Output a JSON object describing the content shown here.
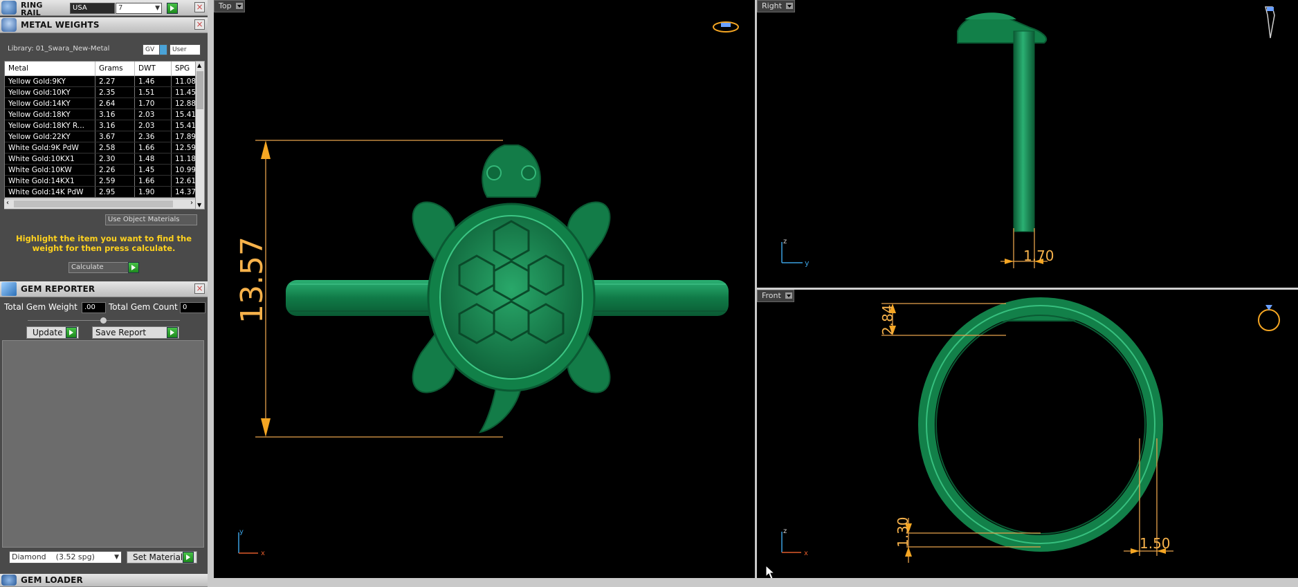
{
  "ring_rail": {
    "title": "RING RAIL",
    "country": "USA",
    "size": "7"
  },
  "metal_weights": {
    "title": "METAL WEIGHTS",
    "library": "Library: 01_Swara_New-Metal",
    "gv_label": "GV",
    "user_label": "User",
    "columns": [
      "Metal",
      "Grams",
      "DWT",
      "SPG"
    ],
    "rows": [
      [
        "Yellow Gold:9KY",
        "2.27",
        "1.46",
        "11.08"
      ],
      [
        "Yellow Gold:10KY",
        "2.35",
        "1.51",
        "11.45"
      ],
      [
        "Yellow Gold:14KY",
        "2.64",
        "1.70",
        "12.88"
      ],
      [
        "Yellow Gold:18KY",
        "3.16",
        "2.03",
        "15.41"
      ],
      [
        "Yellow Gold:18KY R...",
        "3.16",
        "2.03",
        "15.41"
      ],
      [
        "Yellow Gold:22KY",
        "3.67",
        "2.36",
        "17.89"
      ],
      [
        "White Gold:9K PdW",
        "2.58",
        "1.66",
        "12.59"
      ],
      [
        "White Gold:10KX1",
        "2.30",
        "1.48",
        "11.18"
      ],
      [
        "White Gold:10KW",
        "2.26",
        "1.45",
        "10.99"
      ],
      [
        "White Gold:14KX1",
        "2.59",
        "1.66",
        "12.61"
      ],
      [
        "White Gold:14K PdW",
        "2.95",
        "1.90",
        "14.37"
      ]
    ],
    "use_object_materials": "Use Object Materials",
    "instruction": "Highlight the item you want to find the weight for then press calculate.",
    "calculate_label": "Calculate"
  },
  "gem_reporter": {
    "title": "GEM REPORTER",
    "total_gem_weight_label": "Total Gem Weight",
    "total_gem_weight_value": ".00",
    "total_gem_count_label": "Total Gem Count",
    "total_gem_count_value": "0",
    "update_label": "Update",
    "save_report_label": "Save Report",
    "material_select": "Diamond    (3.52 spg)",
    "set_material_label": "Set Material"
  },
  "gem_loader": {
    "title": "GEM LOADER"
  },
  "viewports": {
    "top": {
      "label": "Top",
      "dimension": "13.57"
    },
    "right": {
      "label": "Right",
      "dimension": "1.70",
      "axis_v": "z",
      "axis_h": "y"
    },
    "front": {
      "label": "Front",
      "dim_top": "2.84",
      "dim_bottom": "1.30",
      "dim_right": "1.50",
      "axis_v": "z",
      "axis_h": "x"
    },
    "top_axes": {
      "v": "y",
      "h": "x"
    }
  },
  "colors": {
    "model_green": "#1a8a52",
    "dimension_orange": "#f5a623",
    "instruction_yellow": "#ffd21e"
  }
}
